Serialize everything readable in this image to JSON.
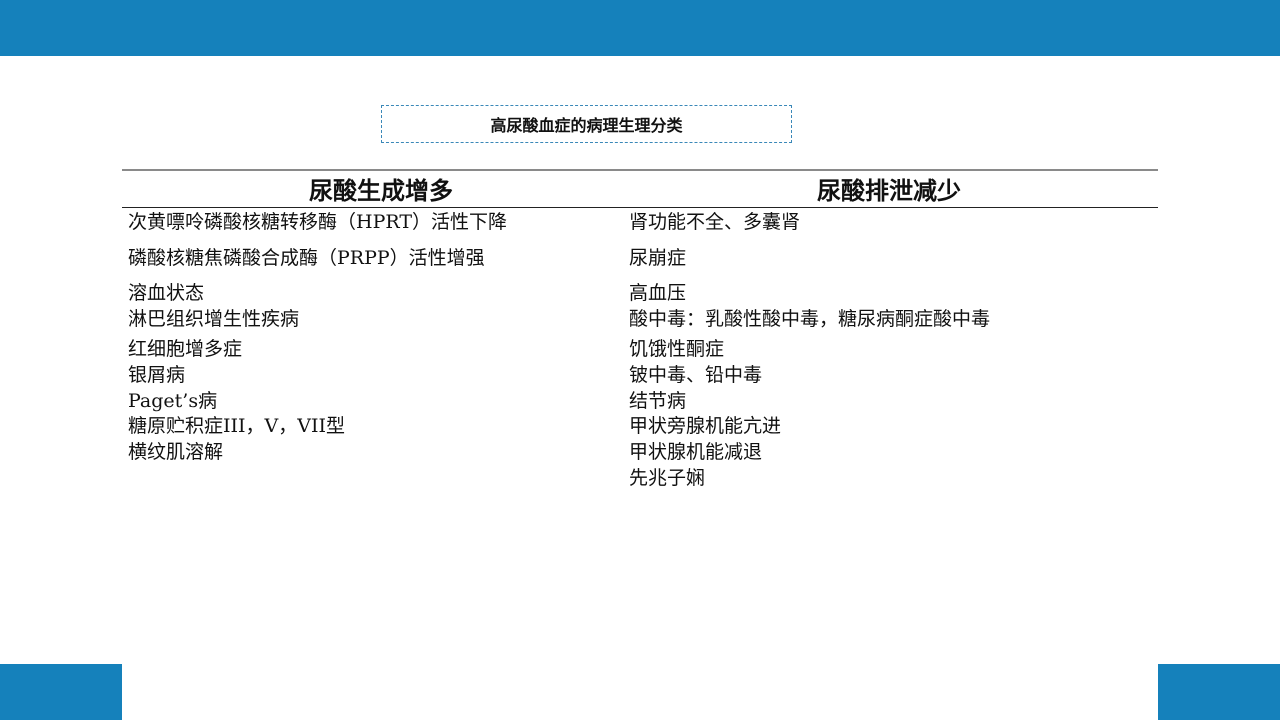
{
  "title": "高尿酸血症的病理生理分类",
  "table": {
    "headers": {
      "left": "尿酸生成增多",
      "right": "尿酸排泄减少"
    },
    "left_lines": [
      "次黄嘌呤磷酸核糖转移酶（HPRT）活性下降",
      "磷酸核糖焦磷酸合成酶（PRPP）活性增强",
      "溶血状态",
      "淋巴组织增生性疾病",
      "红细胞增多症",
      "银屑病",
      "Paget’s病",
      "糖原贮积症III，V，VII型",
      "横纹肌溶解"
    ],
    "right_lines": [
      "肾功能不全、多囊肾",
      "尿崩症",
      "高血压",
      "酸中毒：乳酸性酸中毒，糖尿病酮症酸中毒",
      "饥饿性酮症",
      "铍中毒、铅中毒",
      "结节病",
      "甲状旁腺机能亢进",
      "甲状腺机能减退",
      "先兆子娴"
    ]
  },
  "colors": {
    "accent": "#1581bb"
  }
}
